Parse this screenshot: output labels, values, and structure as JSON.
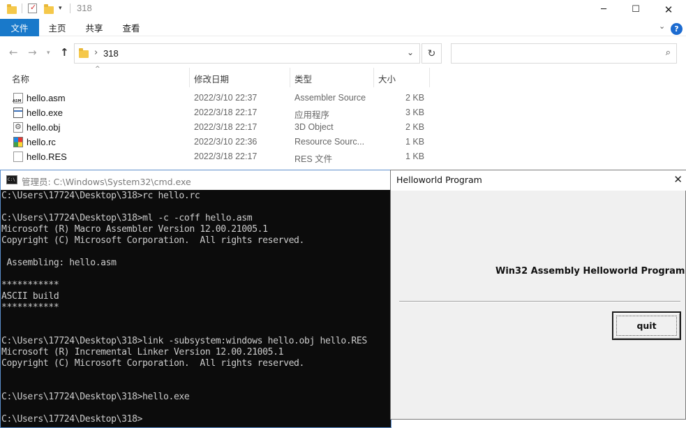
{
  "explorer": {
    "title": "318",
    "ribbon_tabs": [
      "文件",
      "主页",
      "共享",
      "查看"
    ],
    "address_path": "318",
    "search_placeholder": "",
    "columns": [
      "名称",
      "修改日期",
      "类型",
      "大小"
    ],
    "files": [
      {
        "name": "hello.asm",
        "date": "2022/3/10 22:37",
        "type": "Assembler Source",
        "size": "2 KB",
        "icon": "asm-file-icon"
      },
      {
        "name": "hello.exe",
        "date": "2022/3/18 22:17",
        "type": "应用程序",
        "size": "3 KB",
        "icon": "exe-file-icon"
      },
      {
        "name": "hello.obj",
        "date": "2022/3/18 22:17",
        "type": "3D Object",
        "size": "2 KB",
        "icon": "obj-file-icon"
      },
      {
        "name": "hello.rc",
        "date": "2022/3/10 22:36",
        "type": "Resource Sourc...",
        "size": "1 KB",
        "icon": "rc-file-icon"
      },
      {
        "name": "hello.RES",
        "date": "2022/3/18 22:17",
        "type": "RES 文件",
        "size": "1 KB",
        "icon": "res-file-icon"
      }
    ]
  },
  "cmd": {
    "title": "管理员: C:\\Windows\\System32\\cmd.exe",
    "icon_text": "C:\\",
    "lines": [
      "C:\\Users\\17724\\Desktop\\318>rc hello.rc",
      "",
      "C:\\Users\\17724\\Desktop\\318>ml -c -coff hello.asm",
      "Microsoft (R) Macro Assembler Version 12.00.21005.1",
      "Copyright (C) Microsoft Corporation.  All rights reserved.",
      "",
      " Assembling: hello.asm",
      "",
      "***********",
      "ASCII build",
      "***********",
      "",
      "",
      "C:\\Users\\17724\\Desktop\\318>link -subsystem:windows hello.obj hello.RES",
      "Microsoft (R) Incremental Linker Version 12.00.21005.1",
      "Copyright (C) Microsoft Corporation.  All rights reserved.",
      "",
      "",
      "C:\\Users\\17724\\Desktop\\318>hello.exe",
      "",
      "C:\\Users\\17724\\Desktop\\318>"
    ]
  },
  "dialog": {
    "title": "Helloworld Program",
    "message": "Win32 Assembly Helloworld Program",
    "quit_label": "quit"
  }
}
